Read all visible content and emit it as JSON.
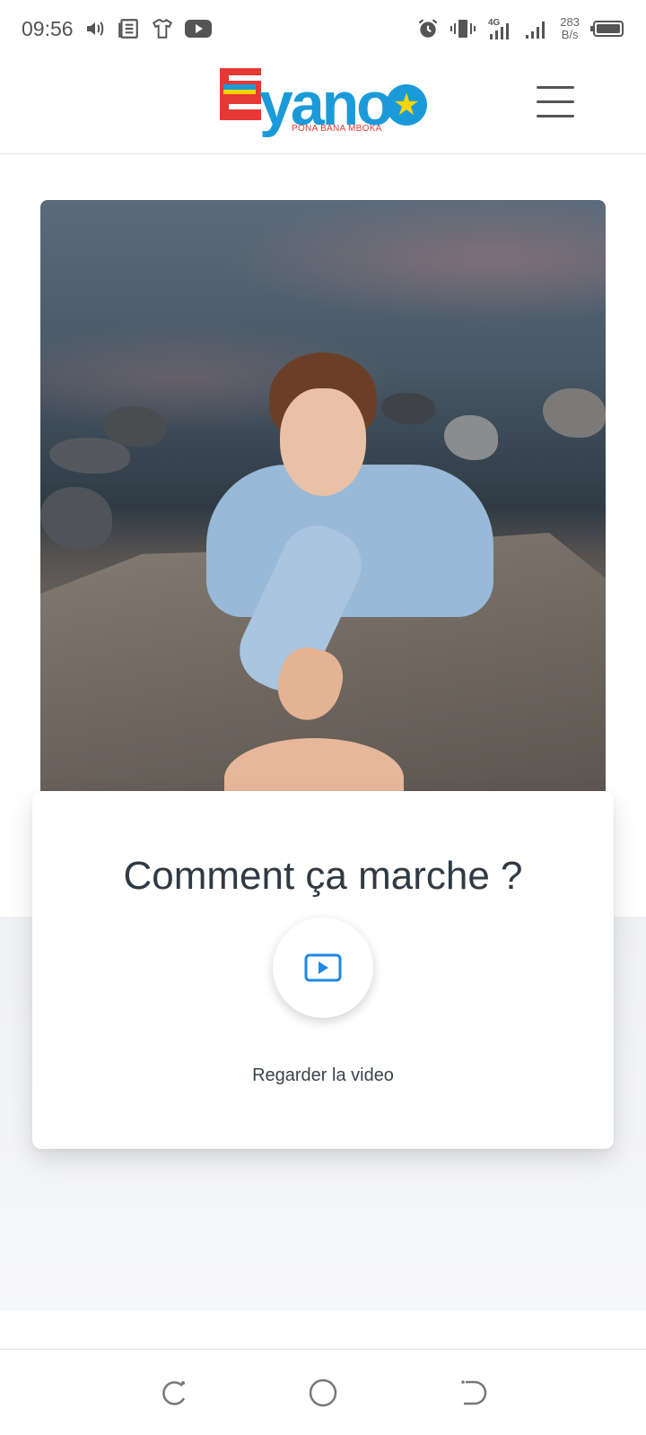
{
  "status_bar": {
    "time": "09:56",
    "network": "4G",
    "speed_value": "283",
    "speed_unit": "B/s",
    "icons": [
      "volume-icon",
      "news-icon",
      "tshirt-icon",
      "youtube-icon",
      "alarm-icon",
      "vibrate-icon",
      "signal-4g-icon",
      "signal-icon",
      "battery-icon"
    ]
  },
  "header": {
    "logo": {
      "brand": "yano",
      "tagline": "PONA BANA MBOKA",
      "colors": {
        "blue": "#1b9ad9",
        "red": "#e53935",
        "yellow": "#ffd400"
      }
    },
    "menu_icon": "hamburger-menu-icon"
  },
  "hero": {
    "description_icon": "hero-photo"
  },
  "card": {
    "title": "Comment ça marche ?",
    "play_icon": "play-video-icon",
    "caption": "Regarder la video",
    "accent_color": "#1e88e5"
  },
  "nav_bar": {
    "icons": [
      "recents-icon",
      "home-icon",
      "back-icon"
    ]
  }
}
